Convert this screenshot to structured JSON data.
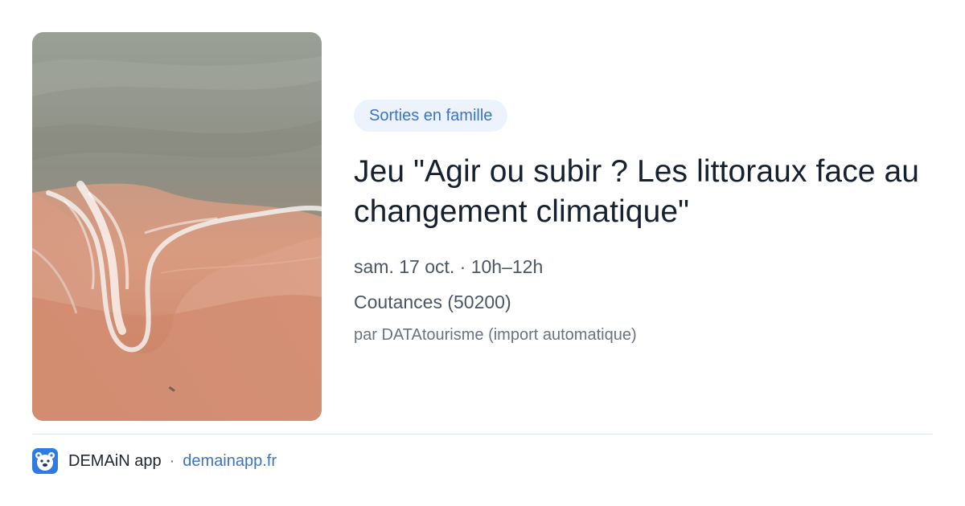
{
  "event": {
    "category": "Sorties en famille",
    "title": "Jeu \"Agir ou subir ? Les littoraux face au changement climatique\"",
    "date_time": "sam. 17 oct. · 10h–12h",
    "location": "Coutances (50200)",
    "source": "par DATAtourisme (import automatique)",
    "image_alt": "aerial beach with wave"
  },
  "footer": {
    "app_name": "DEMAiN app",
    "separator": "·",
    "domain": "demainapp.fr",
    "logo_icon": "bear-face-icon"
  },
  "colors": {
    "accent": "#3b74c7",
    "badge_bg": "#edf3fc",
    "title": "#17202f",
    "meta": "#4b5563",
    "muted": "#6b7280",
    "sea": "#8f9187",
    "sand": "#d48e71"
  }
}
